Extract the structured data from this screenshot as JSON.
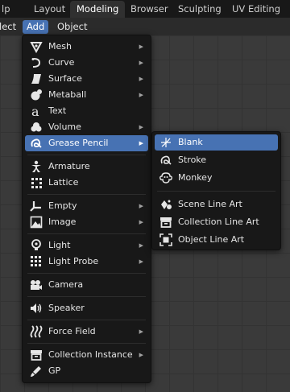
{
  "topbar": {
    "tabs": [
      {
        "label": "lp"
      },
      {
        "label": "Layout"
      },
      {
        "label": "Modeling"
      },
      {
        "label": "Browser"
      },
      {
        "label": "Sculpting"
      },
      {
        "label": "UV Editing"
      }
    ]
  },
  "header": {
    "items": [
      {
        "label": "lect"
      },
      {
        "label": "Add"
      },
      {
        "label": "Object"
      }
    ]
  },
  "add_menu": {
    "items": [
      {
        "label": "Mesh",
        "icon": "mesh-icon"
      },
      {
        "label": "Curve",
        "icon": "curve-icon"
      },
      {
        "label": "Surface",
        "icon": "surface-icon"
      },
      {
        "label": "Metaball",
        "icon": "metaball-icon"
      },
      {
        "label": "Text",
        "icon": "text-icon"
      },
      {
        "label": "Volume",
        "icon": "volume-icon"
      },
      {
        "label": "Grease Pencil",
        "icon": "grease-pencil-icon"
      },
      {
        "label": "Armature",
        "icon": "armature-icon"
      },
      {
        "label": "Lattice",
        "icon": "lattice-icon"
      },
      {
        "label": "Empty",
        "icon": "empty-icon"
      },
      {
        "label": "Image",
        "icon": "image-icon"
      },
      {
        "label": "Light",
        "icon": "light-icon"
      },
      {
        "label": "Light Probe",
        "icon": "light-probe-icon"
      },
      {
        "label": "Camera",
        "icon": "camera-icon"
      },
      {
        "label": "Speaker",
        "icon": "speaker-icon"
      },
      {
        "label": "Force Field",
        "icon": "force-field-icon"
      },
      {
        "label": "Collection Instance",
        "icon": "collection-icon"
      },
      {
        "label": "GP",
        "icon": "brush-icon"
      }
    ]
  },
  "grease_pencil_submenu": {
    "items": [
      {
        "label": "Blank",
        "icon": "blank-icon"
      },
      {
        "label": "Stroke",
        "icon": "stroke-icon"
      },
      {
        "label": "Monkey",
        "icon": "monkey-icon"
      },
      {
        "label": "Scene Line Art",
        "icon": "scene-line-art-icon"
      },
      {
        "label": "Collection Line Art",
        "icon": "collection-line-art-icon"
      },
      {
        "label": "Object Line Art",
        "icon": "object-line-art-icon"
      }
    ]
  },
  "colors": {
    "accent": "#4772b3",
    "menu_bg": "#181818",
    "text": "#e6e6e6"
  }
}
